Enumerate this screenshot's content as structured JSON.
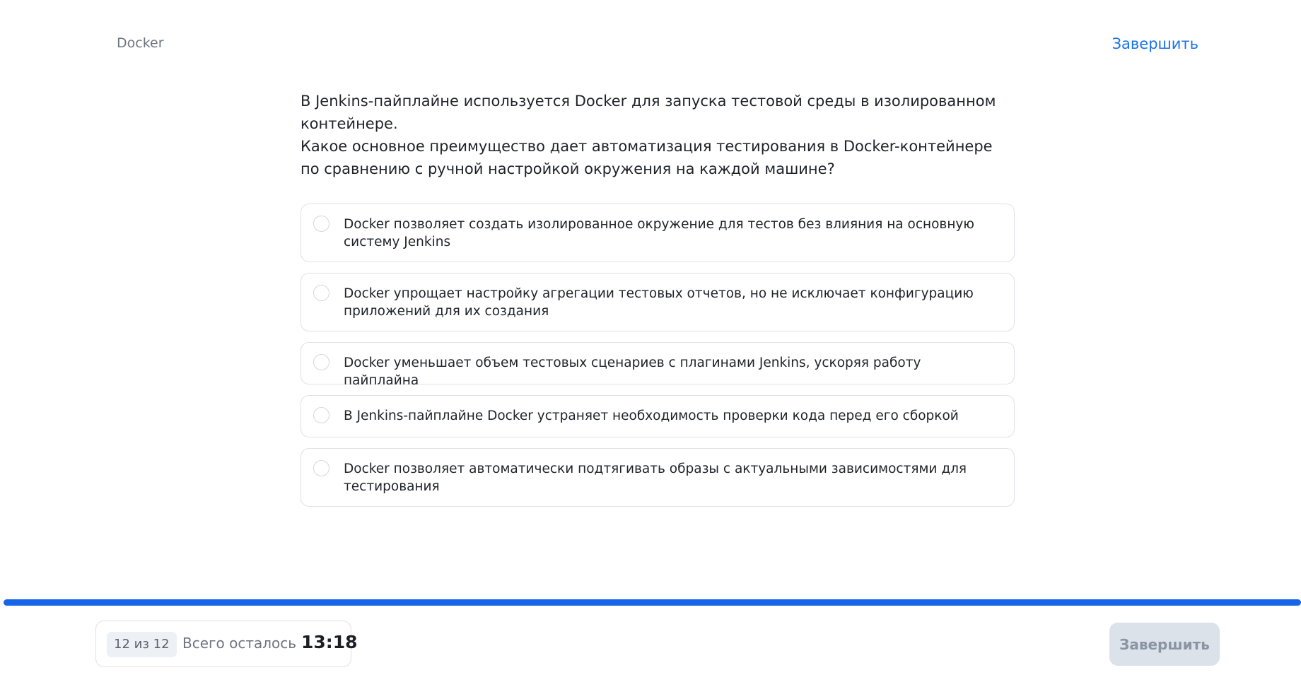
{
  "header": {
    "topic": "Docker",
    "finish_link_label": "Завершить"
  },
  "question": {
    "line1": "В Jenkins-пайплайне используется Docker для запуска тестовой среды в изолированном контейнере.",
    "line2": "Какое основное преимущество дает автоматизация тестирования в Docker-контейнере по сравнению с ручной настройкой окружения на каждой машине?"
  },
  "options": [
    {
      "text": "Docker позволяет создать изолированное окружение для тестов без влияния на основную систему Jenkins",
      "selected": false
    },
    {
      "text": "Docker упрощает настройку агрегации тестовых отчетов, но не исключает конфигурацию приложений для их создания",
      "selected": false
    },
    {
      "text": "Docker уменьшает объем тестовых сценариев с плагинами Jenkins, ускоряя работу пайплайна",
      "selected": false
    },
    {
      "text": "В Jenkins-пайплайне Docker устраняет необходимость проверки кода перед его сборкой",
      "selected": false
    },
    {
      "text": "Docker позволяет автоматически подтягивать образы с актуальными зависимостями для тестирования",
      "selected": false
    }
  ],
  "progress": {
    "current": 12,
    "total": 12,
    "fraction": 1.0
  },
  "footer": {
    "counter": "12 из 12",
    "remaining_label": "Всего осталось",
    "timer": "13:18",
    "finish_button_label": "Завершить"
  },
  "colors": {
    "accent": "#1665e8",
    "link": "#1a73e8",
    "button_disabled_bg": "#dbe2ea",
    "button_disabled_text": "#8a94a3"
  }
}
